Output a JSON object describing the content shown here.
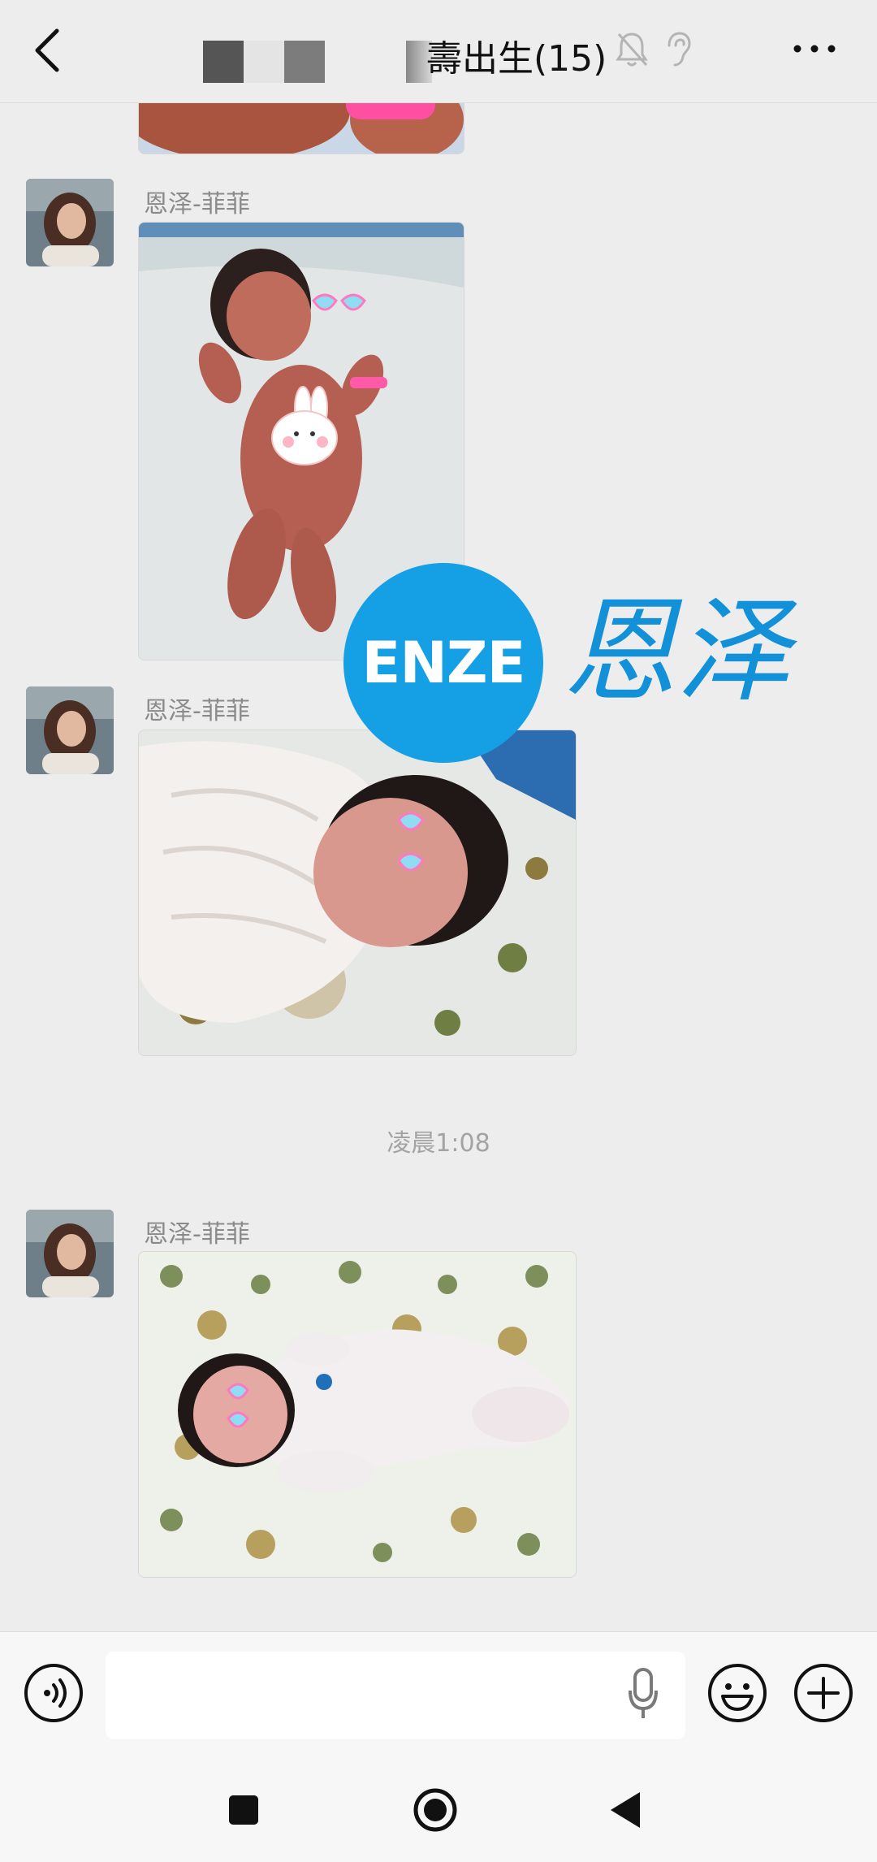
{
  "header": {
    "title": "壽出生(15)",
    "back_icon": "chevron-left-icon",
    "mute_icon": "bell-off-icon",
    "earpiece_icon": "ear-icon",
    "more_icon": "more-horizontal-icon"
  },
  "messages": [
    {
      "sender": "恩泽-菲菲",
      "type": "image",
      "description": "newborn baby lying on white blanket"
    },
    {
      "sender": "恩泽-菲菲",
      "type": "image",
      "description": "newborn baby in white swaddle"
    },
    {
      "sender": "恩泽-菲菲",
      "type": "image",
      "description": "newborn baby on patterned sheet"
    }
  ],
  "timestamp": "凌晨1:08",
  "watermark": {
    "badge": "ENZE",
    "script": "恩泽"
  },
  "input_bar": {
    "voice_icon": "voice-toggle-icon",
    "placeholder": "",
    "mic_icon": "microphone-icon",
    "emoji_icon": "emoji-icon",
    "plus_icon": "plus-icon"
  },
  "nav": {
    "recent_icon": "square-icon",
    "home_icon": "circle-icon",
    "back_icon": "triangle-back-icon"
  },
  "colors": {
    "accent": "#159fe4",
    "background": "#ededed"
  }
}
